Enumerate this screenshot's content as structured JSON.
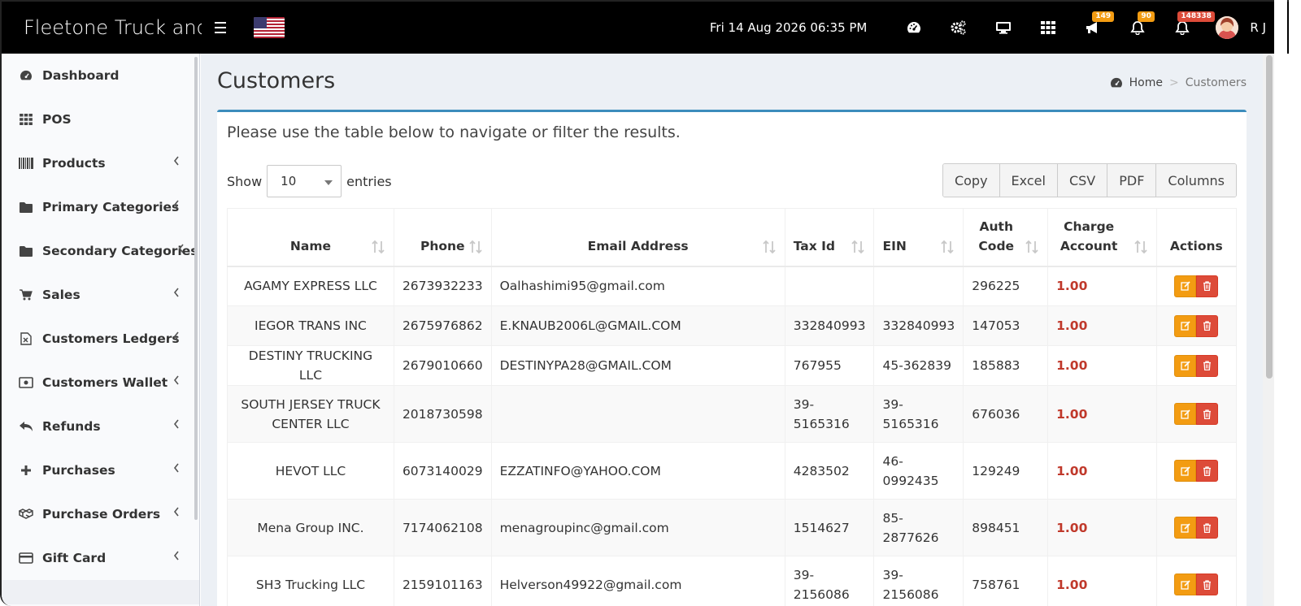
{
  "app": {
    "title": "Fleetone Truck and"
  },
  "topbar": {
    "datetime": "Fri 14 Aug 2026 06:35 PM",
    "icons": [
      {
        "name": "dashboard-icon"
      },
      {
        "name": "settings-icon"
      },
      {
        "name": "monitor-icon"
      },
      {
        "name": "apps-grid-icon"
      },
      {
        "name": "megaphone-icon",
        "badge": "149",
        "badge_color": "#f39c12"
      },
      {
        "name": "bell-icon",
        "badge": "90",
        "badge_color": "#f39c12"
      },
      {
        "name": "bell-alert-icon",
        "badge": "148338",
        "badge_color": "#dd4b39"
      }
    ],
    "user": "R J"
  },
  "sidebar": {
    "items": [
      {
        "label": "Dashboard",
        "icon": "dashboard-icon",
        "has_children": false
      },
      {
        "label": "POS",
        "icon": "grid-icon",
        "has_children": false
      },
      {
        "label": "Products",
        "icon": "barcode-icon",
        "has_children": true
      },
      {
        "label": "Primary Categories",
        "icon": "folder-icon",
        "has_children": true
      },
      {
        "label": "Secondary Categories",
        "icon": "folder-icon",
        "has_children": true
      },
      {
        "label": "Sales",
        "icon": "cart-icon",
        "has_children": true
      },
      {
        "label": "Customers Ledgers",
        "icon": "ledger-icon",
        "has_children": true
      },
      {
        "label": "Customers Wallet",
        "icon": "wallet-icon",
        "has_children": true
      },
      {
        "label": "Refunds",
        "icon": "reply-icon",
        "has_children": true
      },
      {
        "label": "Purchases",
        "icon": "plus-icon",
        "has_children": true
      },
      {
        "label": "Purchase Orders",
        "icon": "cubes-icon",
        "has_children": true
      },
      {
        "label": "Gift Card",
        "icon": "credit-card-icon",
        "has_children": true
      }
    ]
  },
  "page": {
    "title": "Customers",
    "breadcrumb": {
      "home": "Home",
      "current": "Customers"
    },
    "intro": "Please use the table below to navigate or filter the results.",
    "show_label": "Show",
    "entries_label": "entries",
    "entries_value": "10",
    "buttons": [
      "Copy",
      "Excel",
      "CSV",
      "PDF",
      "Columns"
    ]
  },
  "table": {
    "headers": [
      "Name",
      "Phone",
      "Email Address",
      "Tax Id",
      "EIN",
      "Auth Code",
      "Charge Account",
      "Actions"
    ],
    "rows": [
      {
        "name": "AGAMY EXPRESS LLC",
        "phone": "2673932233",
        "email": "Oalhashimi95@gmail.com",
        "tax_id": "",
        "ein": "",
        "auth": "296225",
        "charge": "1.00"
      },
      {
        "name": "IEGOR TRANS INC",
        "phone": "2675976862",
        "email": "E.KNAUB2006L@GMAIL.COM",
        "tax_id": "332840993",
        "ein": "332840993",
        "auth": "147053",
        "charge": "1.00"
      },
      {
        "name": "DESTINY TRUCKING LLC",
        "phone": "2679010660",
        "email": "DESTINYPA28@GMAIL.COM",
        "tax_id": "767955",
        "ein": "45-362839",
        "auth": "185883",
        "charge": "1.00"
      },
      {
        "name": "SOUTH JERSEY TRUCK CENTER LLC",
        "phone": "2018730598",
        "email": "",
        "tax_id": "39-5165316",
        "ein": "39-5165316",
        "auth": "676036",
        "charge": "1.00"
      },
      {
        "name": "HEVOT LLC",
        "phone": "6073140029",
        "email": "EZZATINFO@YAHOO.COM",
        "tax_id": "4283502",
        "ein": "46-0992435",
        "auth": "129249",
        "charge": "1.00"
      },
      {
        "name": "Mena Group INC.",
        "phone": "7174062108",
        "email": "menagroupinc@gmail.com",
        "tax_id": "1514627",
        "ein": "85-2877626",
        "auth": "898451",
        "charge": "1.00"
      },
      {
        "name": "SH3 Trucking LLC",
        "phone": "2159101163",
        "email": "Helverson49922@gmail.com",
        "tax_id": "39-2156086",
        "ein": "39-2156086",
        "auth": "758761",
        "charge": "1.00"
      }
    ]
  }
}
